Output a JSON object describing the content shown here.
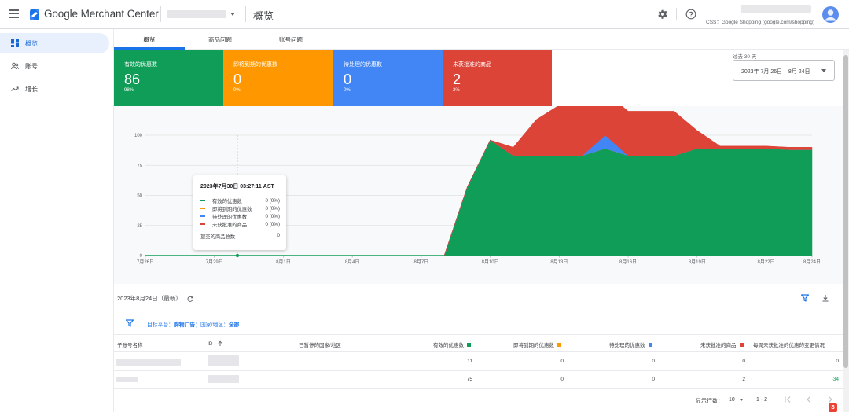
{
  "header": {
    "brand": "Google Merchant Center",
    "page_title": "概览",
    "css_label": "CSS：Google Shopping (google.com/shopping)"
  },
  "sidebar": {
    "items": [
      {
        "label": "概览",
        "icon": "dashboard-icon",
        "active": true
      },
      {
        "label": "账号",
        "icon": "people-icon",
        "active": false
      },
      {
        "label": "增长",
        "icon": "trending-up-icon",
        "active": false
      }
    ]
  },
  "tabs": [
    "概览",
    "商品问题",
    "账号问题"
  ],
  "cards": [
    {
      "label": "有效的优惠数",
      "value": "86",
      "pct": "98%",
      "color": "#0f9d58"
    },
    {
      "label": "即将到期的优惠数",
      "value": "0",
      "pct": "0%",
      "color": "#ff9800"
    },
    {
      "label": "待处理的优惠数",
      "value": "0",
      "pct": "0%",
      "color": "#4285f4"
    },
    {
      "label": "未获批准的商品",
      "value": "2",
      "pct": "2%",
      "color": "#db4437"
    }
  ],
  "date_range": {
    "caption": "过去 30 天",
    "value": "2023年 7月 26日 – 8月 24日"
  },
  "chart_data": {
    "type": "area",
    "x": [
      "7月26日",
      "7月27日",
      "7月28日",
      "7月29日",
      "7月30日",
      "7月31日",
      "8月1日",
      "8月2日",
      "8月3日",
      "8月4日",
      "8月5日",
      "8月6日",
      "8月7日",
      "8月8日",
      "8月9日",
      "8月10日",
      "8月11日",
      "8月12日",
      "8月13日",
      "8月14日",
      "8月15日",
      "8月16日",
      "8月17日",
      "8月18日",
      "8月19日",
      "8月20日",
      "8月21日",
      "8月22日",
      "8月23日",
      "8月24日"
    ],
    "x_tick_labels": [
      "7月26日",
      "7月29日",
      "8月1日",
      "8月4日",
      "8月7日",
      "8月10日",
      "8月13日",
      "8月16日",
      "8月19日",
      "8月22日",
      "8月24日"
    ],
    "y_ticks": [
      0,
      25,
      50,
      75,
      100
    ],
    "ylim": [
      0,
      100
    ],
    "series": [
      {
        "name": "有效的优惠数",
        "color": "#0f9d58",
        "values": [
          0,
          0,
          0,
          0,
          0,
          0,
          0,
          0,
          0,
          0,
          0,
          0,
          0,
          0,
          57,
          96,
          83,
          83,
          83,
          83,
          89,
          83,
          83,
          83,
          89,
          89,
          89,
          89,
          88,
          88
        ]
      },
      {
        "name": "即将到期的优惠数",
        "color": "#ff9800",
        "values": [
          0,
          0,
          0,
          0,
          0,
          0,
          0,
          0,
          0,
          0,
          0,
          0,
          0,
          0,
          0,
          0,
          0,
          0,
          0,
          0,
          0,
          0,
          0,
          0,
          0,
          0,
          0,
          0,
          0,
          0
        ]
      },
      {
        "name": "待处理的优惠数",
        "color": "#4285f4",
        "values": [
          0,
          0,
          0,
          0,
          0,
          0,
          0,
          0,
          0,
          0,
          0,
          0,
          0,
          0,
          0,
          0,
          0,
          0,
          0,
          0,
          11,
          0,
          0,
          0,
          0,
          0,
          0,
          0,
          0,
          0
        ]
      },
      {
        "name": "未获批准的商品",
        "color": "#db4437",
        "values": [
          0,
          0,
          0,
          0,
          0,
          0,
          0,
          0,
          0,
          0,
          0,
          0,
          0,
          0,
          0,
          0,
          7,
          30,
          42,
          42,
          36,
          37,
          37,
          37,
          15,
          2,
          2,
          2,
          2,
          2
        ]
      }
    ],
    "grid": true,
    "legend": "none"
  },
  "tooltip": {
    "title": "2023年7月30日 03:27:11 AST",
    "rows": [
      {
        "label": "有效的优惠数",
        "value": "0 (0%)",
        "color": "#0f9d58"
      },
      {
        "label": "即将到期的优惠数",
        "value": "0 (0%)",
        "color": "#ff9800"
      },
      {
        "label": "待处理的优惠数",
        "value": "0 (0%)",
        "color": "#4285f4"
      },
      {
        "label": "未获批准的商品",
        "value": "0 (0%)",
        "color": "#db4437"
      }
    ],
    "total_label": "提交的商品总数",
    "total_value": "0"
  },
  "table_section": {
    "date": "2023年8月24日（最新）",
    "filter_prefix": "目标平台：",
    "filter_platform": "购物广告",
    "filter_mid": "；国家/地区：",
    "filter_country": "全部"
  },
  "table": {
    "headers": [
      "子账号名称",
      "ID",
      "已暂停的国家/地区",
      "有效的优惠数",
      "即将到期的优惠数",
      "待处理的优惠数",
      "未获批准的商品",
      "每周未获批准的优惠的变更情况"
    ],
    "rows": [
      {
        "active": "11",
        "expiring": "0",
        "pending": "0",
        "disapproved": "0",
        "change": "0"
      },
      {
        "active": "75",
        "expiring": "0",
        "pending": "0",
        "disapproved": "2",
        "change": "-34"
      }
    ]
  },
  "pagination": {
    "rows_label": "显示行数：",
    "rows_value": "10",
    "range": "1 - 2"
  }
}
